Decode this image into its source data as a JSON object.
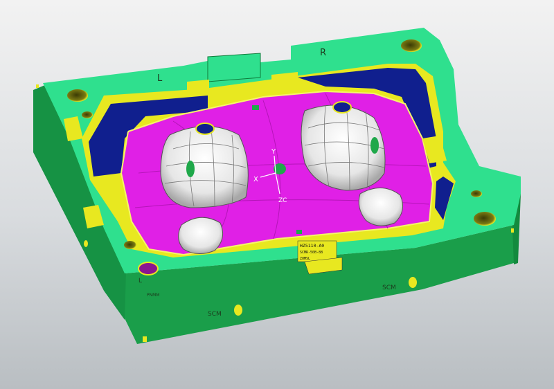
{
  "viewport": {
    "background_top": "#f2f2f2",
    "background_bottom": "#b9bec2"
  },
  "colors": {
    "plate": "#1fb85a",
    "plate_top": "#2de08c",
    "plate_edge": "#0f7a3a",
    "rim": "#e8e820",
    "pocket_wall": "#0f1f8c",
    "parting_surface": "#e020e6",
    "cavity": "#f0f0f0",
    "cavity_shadow": "#bdbdbd",
    "hole_inner": "#6b6b10"
  },
  "engravings": {
    "left_mark": "L",
    "right_mark": "R",
    "front_left_text": "SCM",
    "front_right_text": "SCM",
    "corner_mark": "L",
    "side_tag": "PNMM"
  },
  "nameplate": {
    "line1": "HZ5110-A0",
    "line2": "SCMR-50B-88",
    "line3": "ZUMSL"
  },
  "triad": {
    "x_label": "X",
    "y_label": "Y",
    "z_label": "ZC"
  }
}
